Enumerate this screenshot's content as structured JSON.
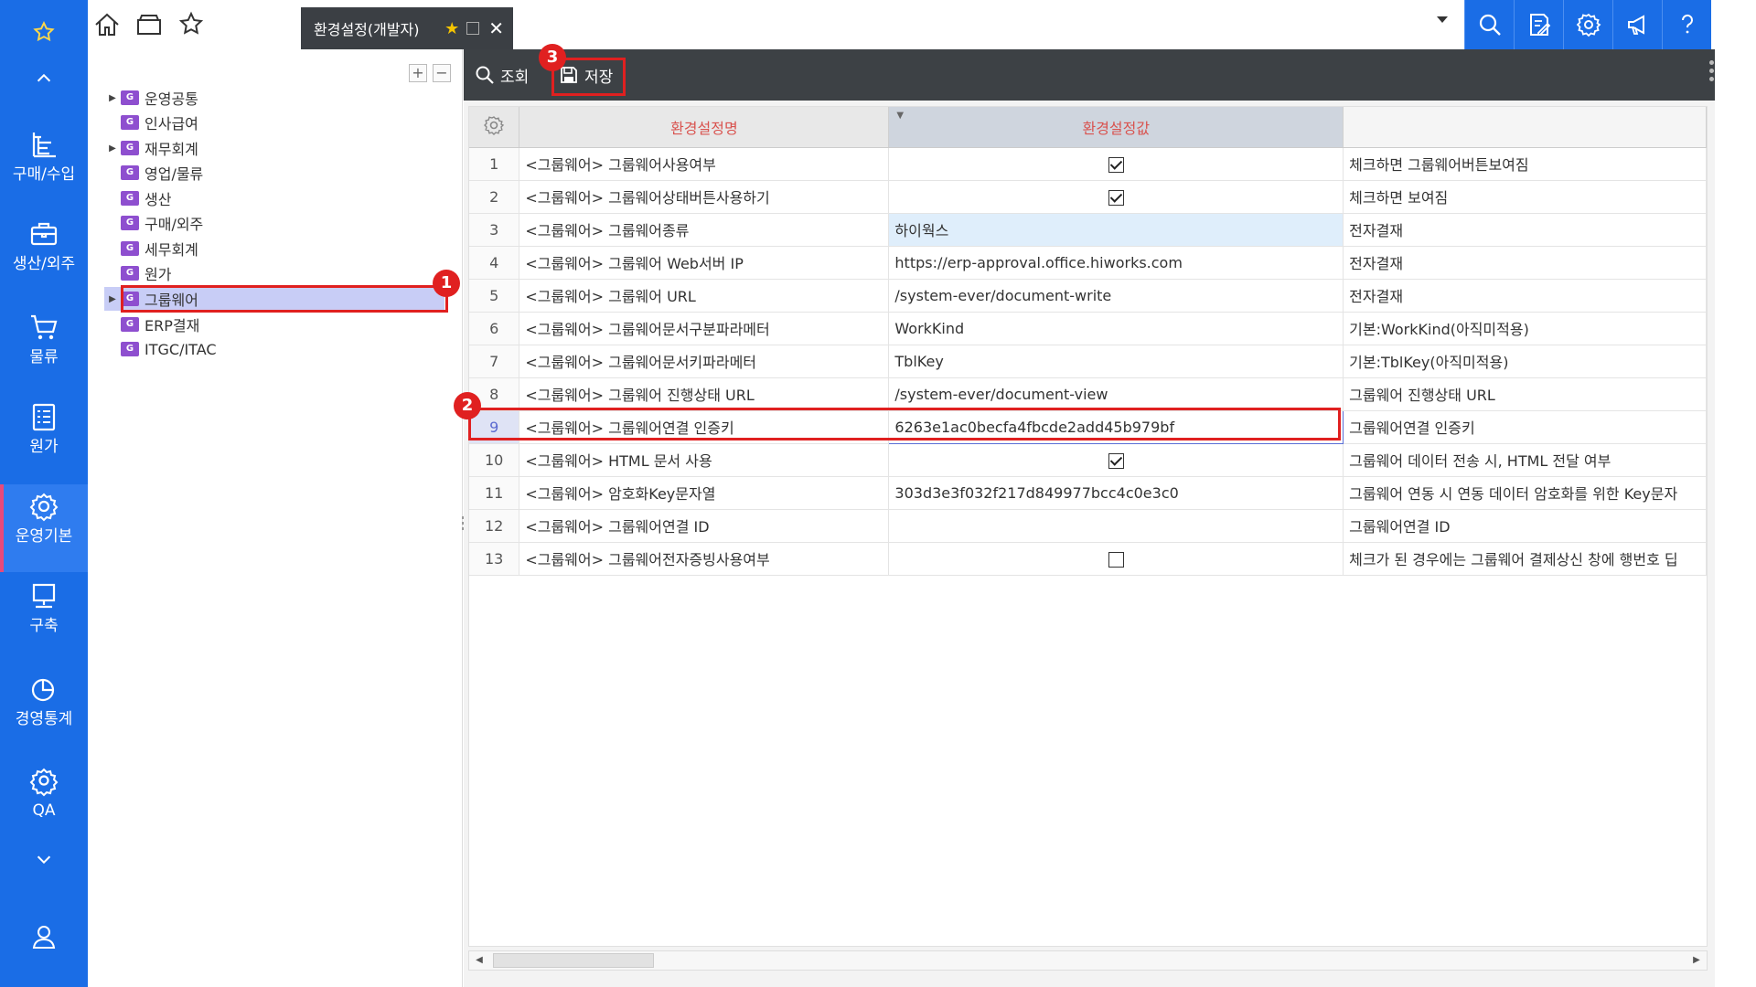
{
  "colors": {
    "nav_bg": "#1a6de6",
    "accent_red": "#e02020",
    "tab_bg": "#3b3f44",
    "toolbar_bg": "#3d4145",
    "selected_tree_bg": "#c8cdf6"
  },
  "nav": {
    "items": [
      {
        "label": "구매/수입",
        "icon": "org-chart-icon"
      },
      {
        "label": "생산/외주",
        "icon": "briefcase-icon"
      },
      {
        "label": "물류",
        "icon": "cart-icon"
      },
      {
        "label": "원가",
        "icon": "list-icon"
      },
      {
        "label": "운영기본",
        "icon": "gear-icon"
      },
      {
        "label": "구축",
        "icon": "monitor-icon"
      },
      {
        "label": "경영통계",
        "icon": "pie-chart-icon"
      },
      {
        "label": "QA",
        "icon": "gear-icon"
      }
    ]
  },
  "topbar": {
    "tab_title": "환경설정(개발자)"
  },
  "tree": {
    "items": [
      {
        "label": "운영공통",
        "has_children": true
      },
      {
        "label": "인사급여",
        "has_children": false
      },
      {
        "label": "재무회계",
        "has_children": true
      },
      {
        "label": "영업/물류",
        "has_children": false
      },
      {
        "label": "생산",
        "has_children": false
      },
      {
        "label": "구매/외주",
        "has_children": false
      },
      {
        "label": "세무회계",
        "has_children": false
      },
      {
        "label": "원가",
        "has_children": false
      },
      {
        "label": "그룹웨어",
        "has_children": true,
        "selected": true
      },
      {
        "label": "ERP결재",
        "has_children": false
      },
      {
        "label": "ITGC/ITAC",
        "has_children": false
      }
    ]
  },
  "toolbar": {
    "search_label": "조회",
    "save_label": "저장"
  },
  "grid": {
    "headers": {
      "name": "환경설정명",
      "value": "환경설정값",
      "desc": ""
    },
    "rows": [
      {
        "no": "1",
        "name": "<그룹웨어>  그룹웨어사용여부",
        "type": "check",
        "checked": true,
        "value": "",
        "desc": "체크하면 그룹웨어버튼보여짐"
      },
      {
        "no": "2",
        "name": "<그룹웨어>  그룹웨어상태버튼사용하기",
        "type": "check",
        "checked": true,
        "value": "",
        "desc": "체크하면 보여짐"
      },
      {
        "no": "3",
        "name": "<그룹웨어>  그룹웨어종류",
        "type": "text",
        "value": "하이웍스",
        "desc": "전자결재"
      },
      {
        "no": "4",
        "name": "<그룹웨어>  그룹웨어 Web서버 IP",
        "type": "text",
        "value": "https://erp-approval.office.hiworks.com",
        "desc": "전자결재"
      },
      {
        "no": "5",
        "name": "<그룹웨어>  그룹웨어 URL",
        "type": "text",
        "value": "/system-ever/document-write",
        "desc": "전자결재"
      },
      {
        "no": "6",
        "name": "<그룹웨어>  그룹웨어문서구분파라메터",
        "type": "text",
        "value": "WorkKind",
        "desc": "기본:WorkKind(아직미적용)"
      },
      {
        "no": "7",
        "name": "<그룹웨어>  그룹웨어문서키파라메터",
        "type": "text",
        "value": "TblKey",
        "desc": "기본:TblKey(아직미적용)"
      },
      {
        "no": "8",
        "name": "<그룹웨어>  그룹웨어 진행상태 URL",
        "type": "text",
        "value": "/system-ever/document-view",
        "desc": "그룹웨어 진행상태 URL"
      },
      {
        "no": "9",
        "name": "<그룹웨어>  그룹웨어연결 인증키",
        "type": "text",
        "value": "6263e1ac0becfa4fbcde2add45b979bf",
        "desc": "그룹웨어연결 인증키"
      },
      {
        "no": "10",
        "name": "<그룹웨어>  HTML 문서 사용",
        "type": "check",
        "checked": true,
        "value": "",
        "desc": "그룹웨어 데이터 전송 시, HTML 전달 여부"
      },
      {
        "no": "11",
        "name": "<그룹웨어>  암호화Key문자열",
        "type": "text",
        "value": "303d3e3f032f217d849977bcc4c0e3c0",
        "desc": "그룹웨어 연동 시 연동 데이터 암호화를 위한 Key문자"
      },
      {
        "no": "12",
        "name": "<그룹웨어>  그룹웨어연결 ID",
        "type": "text",
        "value": "",
        "desc": "그룹웨어연결 ID"
      },
      {
        "no": "13",
        "name": "<그룹웨어>  그룹웨어전자증빙사용여부",
        "type": "check",
        "checked": false,
        "value": "",
        "desc": "체크가 된 경우에는 그룹웨어 결제상신 창에 행번호 딥"
      }
    ]
  },
  "annotations": {
    "badge1": "1",
    "badge2": "2",
    "badge3": "3"
  }
}
